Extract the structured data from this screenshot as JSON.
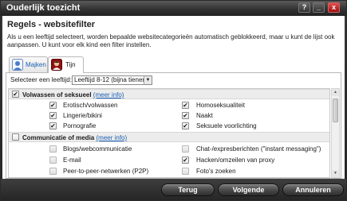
{
  "window": {
    "title": "Ouderlijk toezicht"
  },
  "titlebar_buttons": {
    "help": "?",
    "minimize": "_",
    "close": "x"
  },
  "heading": "Regels - websitefilter",
  "description": "Als u een leeftijd selecteert, worden bepaalde websitecategorieën automatisch geblokkeerd, maar u kunt de lijst ook aanpassen. U kunt voor elk kind een filter instellen.",
  "tabs": [
    {
      "label": "Majken",
      "active": false
    },
    {
      "label": "Tijn",
      "active": true
    }
  ],
  "age": {
    "label": "Selecteer een leeftijd:",
    "value": "Leeftijd 8-12 (bijna tiener)"
  },
  "more_info": "(meer info)",
  "groups": [
    {
      "title": "Volwassen of seksueel",
      "checked": true,
      "items": [
        {
          "left": "Erotisch/volwassen",
          "left_checked": true,
          "right": "Homoseksualiteit",
          "right_checked": true
        },
        {
          "left": "Lingerie/bikini",
          "left_checked": true,
          "right": "Naakt",
          "right_checked": true
        },
        {
          "left": "Pornografie",
          "left_checked": true,
          "right": "Seksuele voorlichting",
          "right_checked": true
        }
      ]
    },
    {
      "title": "Communicatie of media",
      "checked": false,
      "items": [
        {
          "left": "Blogs/webcommunicatie",
          "left_checked": false,
          "right": "Chat-/expresberichten (\"instant messaging\")",
          "right_checked": false
        },
        {
          "left": "E-mail",
          "left_checked": false,
          "right": "Hacken/omzeilen van proxy",
          "right_checked": true
        },
        {
          "left": "Peer-to-peer-netwerken (P2P)",
          "left_checked": false,
          "right": "Foto's zoeken",
          "right_checked": false
        }
      ]
    }
  ],
  "buttons": {
    "back": "Terug",
    "next": "Volgende",
    "cancel": "Annuleren"
  },
  "colors": {
    "titlebar": "#333333",
    "link": "#1a5fb4",
    "close_button": "#c0282d",
    "avatar_red": "#b01818"
  }
}
